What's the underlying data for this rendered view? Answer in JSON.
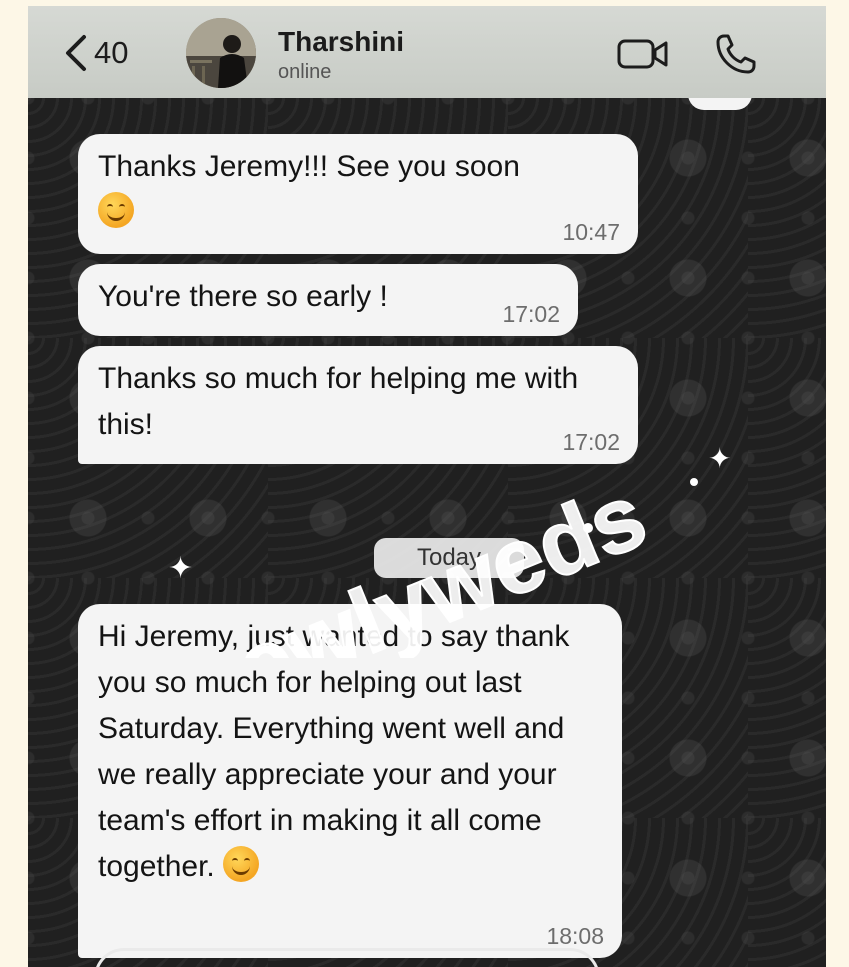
{
  "header": {
    "back_count": "40",
    "contact_name": "Tharshini",
    "contact_status": "online"
  },
  "date_separator": "Today",
  "watermark_text": "newlyweds",
  "messages": [
    {
      "text": "Thanks Jeremy!!! See you soon",
      "emoji": "smiling-face",
      "time": "10:47"
    },
    {
      "text": "You're there so early !",
      "time": "17:02"
    },
    {
      "text": "Thanks so much for helping me with this!",
      "time": "17:02"
    },
    {
      "text": "Hi Jeremy, just wanted to say thank you so much for helping out last Saturday. Everything went well and we really appreciate your and your team's effort in making it all come together.",
      "emoji": "smiling-face",
      "time": "18:08"
    }
  ],
  "colors": {
    "bubble": "#f4f4f4",
    "header": "#d2d5d0",
    "chat_background": "#202020",
    "page_background": "#fdf7e7"
  }
}
